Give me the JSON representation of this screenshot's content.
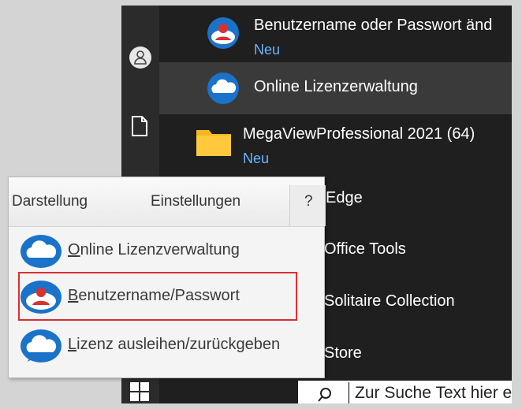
{
  "start_menu": {
    "items": [
      {
        "title": "Benutzername oder Passwort änd",
        "sub": "Neu"
      },
      {
        "title": "Online Lizenzerwaltung",
        "sub": ""
      },
      {
        "title": "MegaViewProfessional 2021 (64)",
        "sub": "Neu"
      }
    ],
    "partial_items": [
      "Edge",
      "Office Tools",
      "Solitaire Collection",
      "Store"
    ],
    "search_placeholder": "Zur Suche Text hier eingeben"
  },
  "app_menu": {
    "menubar": [
      "Darstellung",
      "Einstellungen",
      "?"
    ],
    "items": [
      {
        "accel": "O",
        "rest": "nline Lizenzverwaltung"
      },
      {
        "accel": "B",
        "rest": "enutzername/Passwort"
      },
      {
        "accel": "L",
        "rest": "izenz ausleihen/zurückgeben"
      }
    ]
  },
  "colors": {
    "accent_blue": "#1a73c8",
    "highlight_red": "#d93030",
    "new_badge": "#6db3ff"
  },
  "icons": [
    "user-icon",
    "document-icon",
    "windows-icon",
    "search-icon",
    "cloud-icon",
    "user-cloud-icon",
    "folder-icon"
  ]
}
